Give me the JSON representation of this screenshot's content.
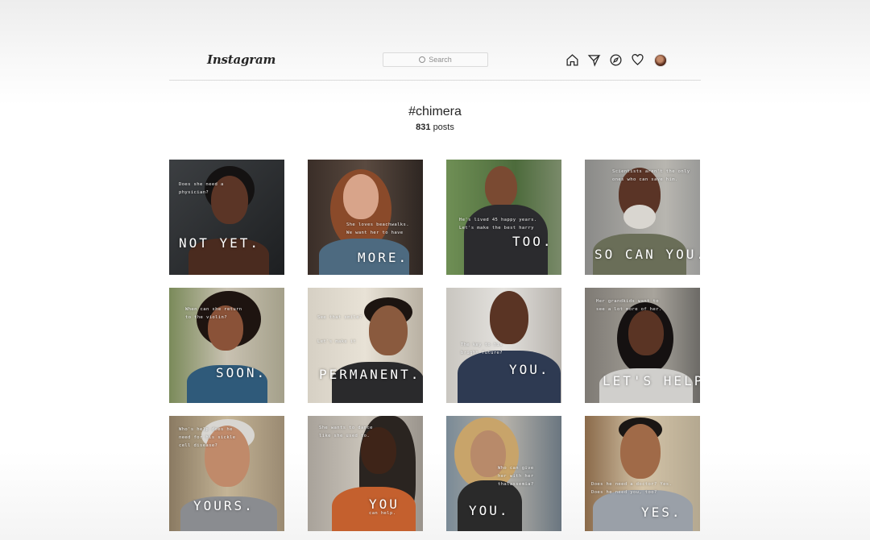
{
  "header": {
    "logo": "Instagram",
    "search_placeholder": "Search",
    "nav_icons": [
      "home-icon",
      "direct-icon",
      "explore-icon",
      "activity-icon",
      "profile-avatar"
    ]
  },
  "hashtag": {
    "title": "#chimera",
    "count": "831",
    "count_label": "posts"
  },
  "posts": [
    {
      "small": "Does she need a\nphysician?",
      "big": "NOT YET."
    },
    {
      "small": "She loves beachwalks.\nWe want her to have",
      "big": "MORE."
    },
    {
      "small": "He's lived 45 happy years.\nLet's make the best harry",
      "big": "TOO."
    },
    {
      "small": "Scientists aren't the only\nones who can save him.",
      "big": "SO CAN YOU."
    },
    {
      "small": "When can she return\nto the violin?",
      "big": "SOON."
    },
    {
      "small": "See that smile?\n\n\nLet's make it",
      "big": "PERMANENT."
    },
    {
      "small": "The key to his\nbright future?",
      "big": "YOU."
    },
    {
      "small": "Her grandkids want to\nsee a lot more of her.",
      "big": "LET'S HELP."
    },
    {
      "small": "Who's help does he\nneed for his sickle\ncell disease?",
      "big": "YOURS."
    },
    {
      "small": "She wants to dance\nlike she used to.",
      "big": "YOU",
      "extra": "can help."
    },
    {
      "small": "Who can give\nher with her\nthalassemia?",
      "big": "YOU."
    },
    {
      "small": "Does he need a doctor? Yes.\nDoes he need you, too?",
      "big": "YES."
    }
  ],
  "colors": {
    "border": "#dbdbdb",
    "text": "#262626",
    "muted": "#8e8e8e"
  }
}
